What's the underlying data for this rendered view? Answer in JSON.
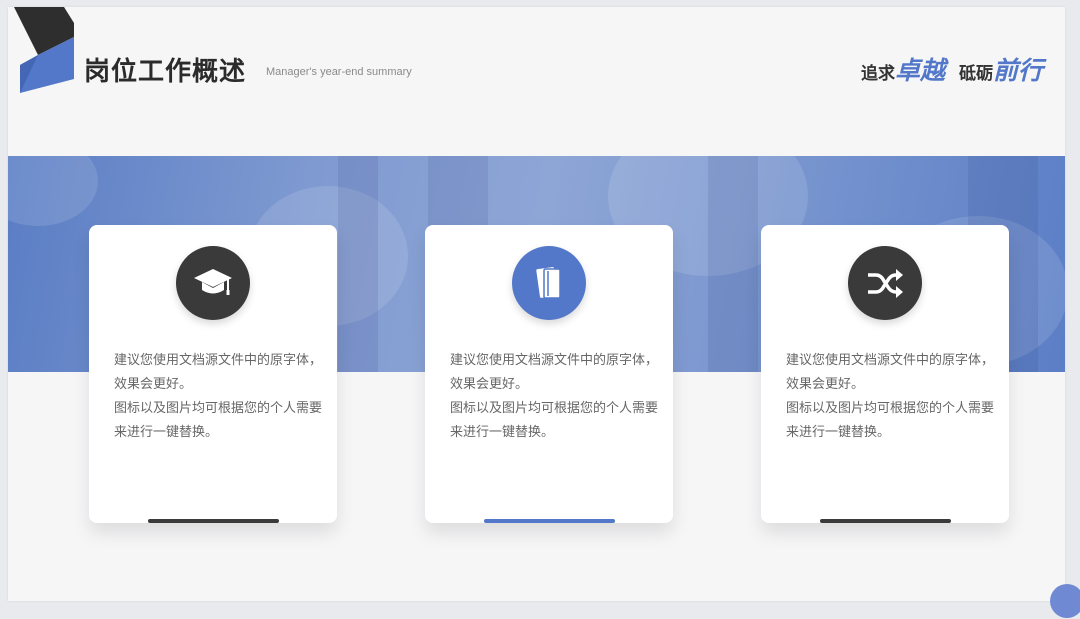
{
  "header": {
    "title": "岗位工作概述",
    "subtitle": "Manager's year-end summary",
    "slogan": [
      {
        "plain": "追求",
        "accent": "卓越"
      },
      {
        "plain": "砥砺",
        "accent": "前行"
      }
    ]
  },
  "colors": {
    "accent": "#5378c9",
    "dark": "#3a3a3a",
    "banner": "#7f9ad1"
  },
  "cards": [
    {
      "icon": "graduation-cap-icon",
      "icon_color": "#3a3a3a",
      "line1": "建议您使用文档源文件中的原字体，效果会更好。",
      "line2": "图标以及图片均可根据您的个人需要来进行一键替换。"
    },
    {
      "icon": "book-icon",
      "icon_color": "#5378c9",
      "line1": "建议您使用文档源文件中的原字体，效果会更好。",
      "line2": "图标以及图片均可根据您的个人需要来进行一键替换。"
    },
    {
      "icon": "shuffle-icon",
      "icon_color": "#3a3a3a",
      "line1": "建议您使用文档源文件中的原字体，效果会更好。",
      "line2": "图标以及图片均可根据您的个人需要来进行一键替换。"
    }
  ]
}
